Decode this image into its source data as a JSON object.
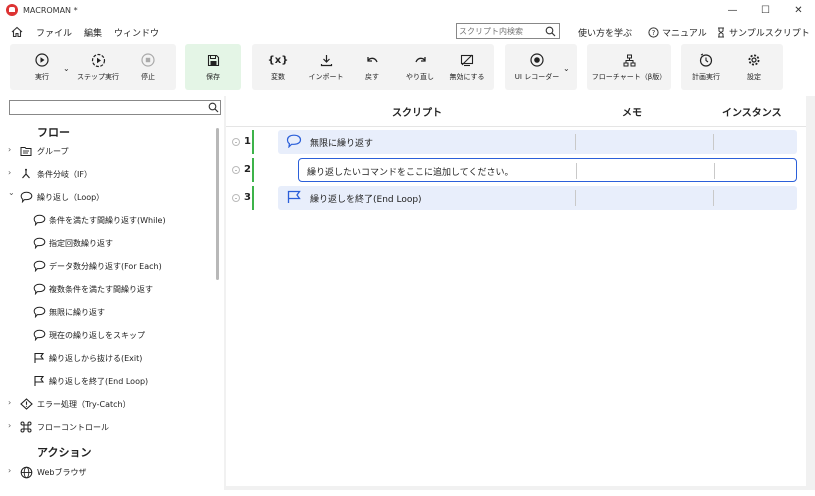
{
  "window": {
    "title": "MACROMAN *",
    "controls": {
      "minimize": "—",
      "maximize": "☐",
      "close": "✕"
    }
  },
  "menu": {
    "items": [
      "ファイル",
      "編集",
      "ウィンドウ"
    ],
    "search_placeholder": "スクリプト内検索",
    "learn": "使い方を学ぶ",
    "manual": "マニュアル",
    "samples": "サンプルスクリプト"
  },
  "toolbar": {
    "run": "実行",
    "step_run": "ステップ実行",
    "stop": "停止",
    "save": "保存",
    "variable": "変数",
    "import": "インポート",
    "undo": "戻す",
    "redo": "やり直し",
    "disable": "無効にする",
    "ui_recorder": "UI レコーダー",
    "flowchart": "フローチャート（β版）",
    "schedule": "計画実行",
    "settings": "設定",
    "dropdown_glyph": "⌄"
  },
  "sidebar": {
    "search_value": "",
    "section_flow": "フロー",
    "section_action": "アクション",
    "items": [
      {
        "label": "グループ",
        "icon": "group-icon",
        "chevron": "›",
        "indent": 0
      },
      {
        "label": "条件分岐（IF）",
        "icon": "branch-icon",
        "chevron": "›",
        "indent": 0
      },
      {
        "label": "繰り返し（Loop）",
        "icon": "loop-icon",
        "chevron": "⌄",
        "indent": 0
      },
      {
        "label": "条件を満たす間繰り返す(While)",
        "icon": "loop-icon",
        "chevron": "",
        "indent": 1
      },
      {
        "label": "指定回数繰り返す",
        "icon": "loop-icon",
        "chevron": "",
        "indent": 1
      },
      {
        "label": "データ数分繰り返す(For Each)",
        "icon": "loop-icon",
        "chevron": "",
        "indent": 1
      },
      {
        "label": "複数条件を満たす間繰り返す",
        "icon": "loop-icon",
        "chevron": "",
        "indent": 1
      },
      {
        "label": "無限に繰り返す",
        "icon": "loop-icon",
        "chevron": "",
        "indent": 1
      },
      {
        "label": "現在の繰り返しをスキップ",
        "icon": "loop-icon",
        "chevron": "",
        "indent": 1
      },
      {
        "label": "繰り返しから抜ける(Exit)",
        "icon": "flag-icon",
        "chevron": "",
        "indent": 1
      },
      {
        "label": "繰り返しを終了(End Loop)",
        "icon": "flag-icon",
        "chevron": "",
        "indent": 1
      },
      {
        "label": "エラー処理（Try-Catch）",
        "icon": "warning-icon",
        "chevron": "›",
        "indent": 0
      },
      {
        "label": "フローコントロール",
        "icon": "command-icon",
        "chevron": "›",
        "indent": 0
      }
    ],
    "action_items": [
      {
        "label": "Webブラウザ",
        "icon": "globe-icon",
        "chevron": "›"
      }
    ]
  },
  "script": {
    "headers": {
      "script": "スクリプト",
      "memo": "メモ",
      "instance": "インスタンス"
    },
    "rows": [
      {
        "num": "1",
        "text": "無限に繰り返す",
        "icon": "loop-icon"
      },
      {
        "num": "2",
        "text": "繰り返したいコマンドをここに追加してください。",
        "icon": ""
      },
      {
        "num": "3",
        "text": "繰り返しを終了(End Loop)",
        "icon": "flag-icon"
      }
    ]
  },
  "colors": {
    "accent_blue": "#2b5fd9",
    "row_bg": "#e8eefb",
    "green_bar": "#3db34a",
    "save_bg": "#e4f5e6",
    "logo_red": "#d33333"
  }
}
